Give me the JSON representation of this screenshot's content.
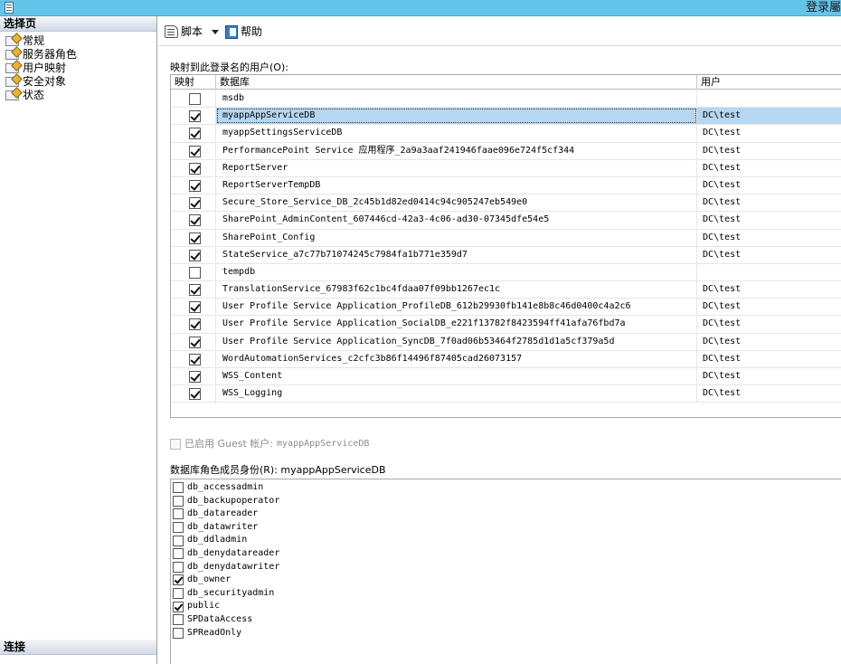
{
  "window": {
    "title": "登录屬",
    "icon": "document-icon"
  },
  "left_pane": {
    "select_page_header": "选择页",
    "pages": [
      {
        "label": "常规",
        "icon": "page-icon"
      },
      {
        "label": "服务器角色",
        "icon": "page-icon"
      },
      {
        "label": "用户映射",
        "icon": "page-icon"
      },
      {
        "label": "安全对象",
        "icon": "page-icon"
      },
      {
        "label": "状态",
        "icon": "page-icon"
      }
    ],
    "connection_header": "连接"
  },
  "toolbar": {
    "script_label": "脚本",
    "help_label": "帮助"
  },
  "mapping": {
    "label": "映射到此登录名的用户(O):",
    "columns": {
      "map": "映射",
      "database": "数据库",
      "user": "用户"
    },
    "rows": [
      {
        "mapped": false,
        "database": "msdb",
        "user": "",
        "selected": false
      },
      {
        "mapped": true,
        "database": "myappAppServiceDB",
        "user": "DC\\test",
        "selected": true
      },
      {
        "mapped": true,
        "database": "myappSettingsServiceDB",
        "user": "DC\\test",
        "selected": false
      },
      {
        "mapped": true,
        "database": "PerformancePoint Service 应用程序_2a9a3aaf241946faae096e724f5cf344",
        "user": "DC\\test",
        "selected": false
      },
      {
        "mapped": true,
        "database": "ReportServer",
        "user": "DC\\test",
        "selected": false
      },
      {
        "mapped": true,
        "database": "ReportServerTempDB",
        "user": "DC\\test",
        "selected": false
      },
      {
        "mapped": true,
        "database": "Secure_Store_Service_DB_2c45b1d82ed0414c94c905247eb549e0",
        "user": "DC\\test",
        "selected": false
      },
      {
        "mapped": true,
        "database": "SharePoint_AdminContent_607446cd-42a3-4c06-ad30-07345dfe54e5",
        "user": "DC\\test",
        "selected": false
      },
      {
        "mapped": true,
        "database": "SharePoint_Config",
        "user": "DC\\test",
        "selected": false
      },
      {
        "mapped": true,
        "database": "StateService_a7c77b71074245c7984fa1b771e359d7",
        "user": "DC\\test",
        "selected": false
      },
      {
        "mapped": false,
        "database": "tempdb",
        "user": "",
        "selected": false
      },
      {
        "mapped": true,
        "database": "TranslationService_67983f62c1bc4fdaa07f09bb1267ec1c",
        "user": "DC\\test",
        "selected": false
      },
      {
        "mapped": true,
        "database": "User Profile Service Application_ProfileDB_612b29930fb141e8b8c46d0400c4a2c6",
        "user": "DC\\test",
        "selected": false
      },
      {
        "mapped": true,
        "database": "User Profile Service Application_SocialDB_e221f13782f8423594ff41afa76fbd7a",
        "user": "DC\\test",
        "selected": false
      },
      {
        "mapped": true,
        "database": "User Profile Service Application_SyncDB_7f0ad06b53464f2785d1d1a5cf379a5d",
        "user": "DC\\test",
        "selected": false
      },
      {
        "mapped": true,
        "database": "WordAutomationServices_c2cfc3b86f14496f87405cad26073157",
        "user": "DC\\test",
        "selected": false
      },
      {
        "mapped": true,
        "database": "WSS_Content",
        "user": "DC\\test",
        "selected": false
      },
      {
        "mapped": true,
        "database": "WSS_Logging",
        "user": "DC\\test",
        "selected": false
      }
    ]
  },
  "guest": {
    "label": "已启用 Guest 帐户:",
    "database": "myappAppServiceDB",
    "enabled": false
  },
  "roles": {
    "label": "数据库角色成员身份(R): myappAppServiceDB",
    "items": [
      {
        "name": "db_accessadmin",
        "checked": false
      },
      {
        "name": "db_backupoperator",
        "checked": false
      },
      {
        "name": "db_datareader",
        "checked": false
      },
      {
        "name": "db_datawriter",
        "checked": false
      },
      {
        "name": "db_ddladmin",
        "checked": false
      },
      {
        "name": "db_denydatareader",
        "checked": false
      },
      {
        "name": "db_denydatawriter",
        "checked": false
      },
      {
        "name": "db_owner",
        "checked": true
      },
      {
        "name": "db_securityadmin",
        "checked": false
      },
      {
        "name": "public",
        "checked": true
      },
      {
        "name": "SPDataAccess",
        "checked": false
      },
      {
        "name": "SPReadOnly",
        "checked": false
      }
    ]
  }
}
